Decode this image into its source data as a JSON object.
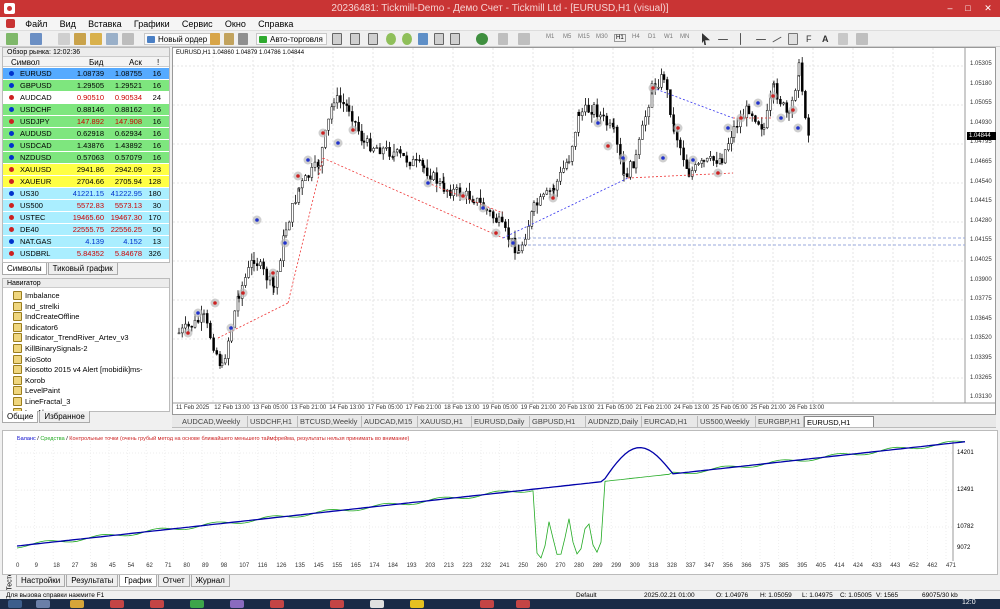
{
  "window": {
    "title": "20236481: Tickmill-Demo - Демо Счет - Tickmill Ltd - [EURUSD,H1 (visual)]"
  },
  "menu": [
    "Файл",
    "Вид",
    "Вставка",
    "Графики",
    "Сервис",
    "Окно",
    "Справка"
  ],
  "toolbar": {
    "new_order": "Новый ордер",
    "autotrading": "Авто-торговля",
    "timeframes": [
      "M1",
      "M5",
      "M15",
      "M30",
      "H1",
      "H4",
      "D1",
      "W1",
      "MN"
    ]
  },
  "market_watch": {
    "header": "Обзор рынка: 12:02:36",
    "columns": {
      "symbol": "Символ",
      "bid": "Бид",
      "ask": "Аск",
      "spread": "!"
    },
    "rows": [
      {
        "symbol": "EURUSD",
        "bid": "1.08739",
        "ask": "1.08755",
        "spread": "16",
        "bg": "#55aaff",
        "dot": "#0033cc",
        "color": "#000"
      },
      {
        "symbol": "GBPUSD",
        "bid": "1.29505",
        "ask": "1.29521",
        "spread": "16",
        "bg": "#7ee67e",
        "dot": "#0033cc",
        "color": "#000"
      },
      {
        "symbol": "AUDCAD",
        "bid": "0.90510",
        "ask": "0.90534",
        "spread": "24",
        "bg": "#ffffff",
        "dot": "#cc2222",
        "color": "#cc0000"
      },
      {
        "symbol": "USDCHF",
        "bid": "0.88146",
        "ask": "0.88162",
        "spread": "16",
        "bg": "#7ee67e",
        "dot": "#0033cc",
        "color": "#000"
      },
      {
        "symbol": "USDJPY",
        "bid": "147.892",
        "ask": "147.908",
        "spread": "16",
        "bg": "#7ee67e",
        "dot": "#cc2222",
        "color": "#cc0000"
      },
      {
        "symbol": "AUDUSD",
        "bid": "0.62918",
        "ask": "0.62934",
        "spread": "16",
        "bg": "#7ee67e",
        "dot": "#0033cc",
        "color": "#000"
      },
      {
        "symbol": "USDCAD",
        "bid": "1.43876",
        "ask": "1.43892",
        "spread": "16",
        "bg": "#7ee67e",
        "dot": "#0033cc",
        "color": "#000"
      },
      {
        "symbol": "NZDUSD",
        "bid": "0.57063",
        "ask": "0.57079",
        "spread": "16",
        "bg": "#7ee67e",
        "dot": "#0033cc",
        "color": "#000"
      },
      {
        "symbol": "XAUUSD",
        "bid": "2941.86",
        "ask": "2942.09",
        "spread": "23",
        "bg": "#ffff44",
        "dot": "#cc2222",
        "color": "#000"
      },
      {
        "symbol": "XAUEUR",
        "bid": "2704.66",
        "ask": "2705.94",
        "spread": "128",
        "bg": "#ffff44",
        "dot": "#cc2222",
        "color": "#000"
      },
      {
        "symbol": "US30",
        "bid": "41221.15",
        "ask": "41222.95",
        "spread": "180",
        "bg": "#aaeeff",
        "dot": "#0033cc",
        "color": "#0033cc"
      },
      {
        "symbol": "US500",
        "bid": "5572.83",
        "ask": "5573.13",
        "spread": "30",
        "bg": "#aaeeff",
        "dot": "#cc2222",
        "color": "#cc0000"
      },
      {
        "symbol": "USTEC",
        "bid": "19465.60",
        "ask": "19467.30",
        "spread": "170",
        "bg": "#aaeeff",
        "dot": "#cc2222",
        "color": "#cc0000"
      },
      {
        "symbol": "DE40",
        "bid": "22555.75",
        "ask": "22556.25",
        "spread": "50",
        "bg": "#aaeeff",
        "dot": "#cc2222",
        "color": "#cc0000"
      },
      {
        "symbol": "NAT.GAS",
        "bid": "4.139",
        "ask": "4.152",
        "spread": "13",
        "bg": "#aaeeff",
        "dot": "#0033cc",
        "color": "#0033cc"
      },
      {
        "symbol": "USDBRL",
        "bid": "5.84352",
        "ask": "5.84678",
        "spread": "326",
        "bg": "#aaeeff",
        "dot": "#cc2222",
        "color": "#cc0000"
      }
    ],
    "tabs": [
      "Символы",
      "Тиковый график"
    ]
  },
  "navigator": {
    "header": "Навигатор",
    "items": [
      "Imbalance",
      "Ind_strelki",
      "IndCreateOffline",
      "Indicator6",
      "Indicator_TrendRiver_Artev_v3",
      "KillBinarySignals-2",
      "KioSoto",
      "Kiosotto 2015 v4 Alert [mobidik]ms-",
      "Korob",
      "LevelPaint",
      "LineFractal_3",
      "LuxAlgo"
    ],
    "tabs": [
      "Общие",
      "Избранное"
    ]
  },
  "chart": {
    "info": "EURUSD,H1  1.04860 1.04879 1.04786 1.04844",
    "current_price": "1.04844",
    "price_ticks": [
      "1.05305",
      "1.05180",
      "1.05055",
      "1.04930",
      "1.04795",
      "1.04665",
      "1.04540",
      "1.04415",
      "1.04280",
      "1.04155",
      "1.04025",
      "1.03900",
      "1.03775",
      "1.03645",
      "1.03520",
      "1.03395",
      "1.03265",
      "1.03130"
    ],
    "time_ticks": [
      "11 Feb 2025",
      "12 Feb 13:00",
      "13 Feb 05:00",
      "13 Feb 21:00",
      "14 Feb 13:00",
      "17 Feb 05:00",
      "17 Feb 21:00",
      "18 Feb 13:00",
      "19 Feb 05:00",
      "19 Feb 21:00",
      "20 Feb 13:00",
      "21 Feb 05:00",
      "21 Feb 21:00",
      "24 Feb 13:00",
      "25 Feb 05:00",
      "25 Feb 21:00",
      "26 Feb 13:00"
    ],
    "tabs": [
      "AUDCAD,Weekly",
      "USDCHF,H1",
      "BTCUSD,Weekly",
      "AUDCAD,M15",
      "XAUUSD,H1",
      "EURUSD,Daily",
      "GBPUSD,H1",
      "AUDNZD,Daily",
      "EURCAD,H1",
      "US500,Weekly",
      "EURGBP,H1",
      "EURUSD,H1 (visual)"
    ]
  },
  "tester": {
    "side_label": "Тестер",
    "legend_balance": "Баланс",
    "legend_equity": "Средства",
    "legend_note": "Контрольные точки (очень грубый метод на основе ближайшего меньшего таймфрейма, результаты нельзя принимать во внимание)",
    "y_ticks": [
      "14201",
      "12491",
      "10782",
      "9072"
    ],
    "x_ticks": [
      "0",
      "9",
      "18",
      "27",
      "36",
      "45",
      "54",
      "62",
      "71",
      "80",
      "89",
      "98",
      "107",
      "116",
      "126",
      "135",
      "145",
      "155",
      "165",
      "174",
      "184",
      "193",
      "203",
      "213",
      "223",
      "232",
      "241",
      "250",
      "260",
      "270",
      "280",
      "289",
      "299",
      "309",
      "318",
      "328",
      "337",
      "347",
      "356",
      "366",
      "375",
      "385",
      "395",
      "405",
      "414",
      "424",
      "433",
      "443",
      "452",
      "462",
      "471"
    ],
    "tabs": [
      "Настройки",
      "Результаты",
      "График",
      "Отчет",
      "Журнал"
    ]
  },
  "statusbar": {
    "help": "Для вызова справки нажмите F1",
    "profile": "Default",
    "datetime": "2025.02.21 01:00",
    "open": "O: 1.04976",
    "high": "H: 1.05059",
    "low": "L: 1.04975",
    "close": "C: 1.05005",
    "volume": "V: 1565",
    "traffic": "69075/30 kb"
  },
  "taskbar": {
    "clock": "12:0"
  }
}
